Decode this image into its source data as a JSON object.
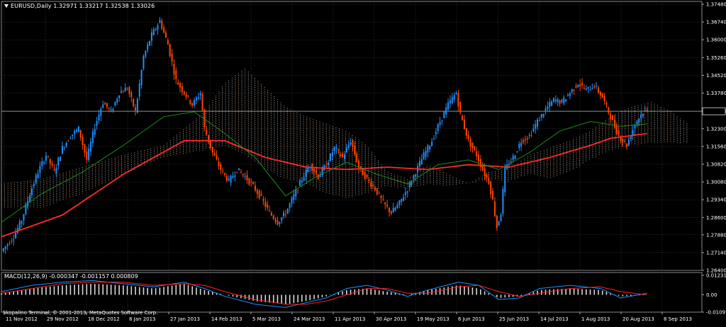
{
  "header": {
    "symbol_label": "EURUSD,Daily",
    "ohlc": "1.32971 1.33217 1.32538 1.33026"
  },
  "macd_header": {
    "label": "MACD(12,26,9) -0.000347 -0.001157 0.000809"
  },
  "footer": {
    "copyright": "Skopalino Terminal, © 2001-2013, MetaQuotes Software Corp."
  },
  "colors": {
    "background": "#000000",
    "bull_candle": "#1e90ff",
    "bear_candle": "#ff4500",
    "ma_slow": "#ff2a2a",
    "ma_fast": "#1d8c1d",
    "cloud_dots": "#e6b08a",
    "cloud_dots_alt": "#d9d9d9",
    "macd_hist": "#d9d9d9",
    "macd_main": "#1e90ff",
    "macd_signal": "#ff2020",
    "grid": "#5a5a5a",
    "current_price_line": "#c0c0c0"
  },
  "chart_data": [
    {
      "type": "candlestick",
      "title": "EURUSD,Daily",
      "ylim": [
        1.264,
        1.3748
      ],
      "y_ticks": [
        "1.37480",
        "1.36740",
        "1.36000",
        "1.35260",
        "1.34520",
        "1.33780",
        "1.33026",
        "1.32300",
        "1.31560",
        "1.30820",
        "1.30080",
        "1.29340",
        "1.28600",
        "1.27880",
        "1.27140",
        "1.26400"
      ],
      "current_price": "1.33026",
      "current_price_value": 1.33026,
      "x_labels": [
        "11 Nov 2012",
        "29 Nov 2012",
        "18 Dec 2012",
        "8 Jan 2013",
        "27 Jan 2013",
        "14 Feb 2013",
        "5 Mar 2013",
        "24 Mar 2013",
        "11 Apr 2013",
        "30 Apr 2013",
        "19 May 2013",
        "6 Jun 2013",
        "25 Jun 2013",
        "14 Jul 2013",
        "1 Aug 2013",
        "20 Aug 2013",
        "8 Sep 2013"
      ],
      "close_path": [
        [
          0,
          1.272
        ],
        [
          6,
          1.278
        ],
        [
          10,
          1.285
        ],
        [
          14,
          1.296
        ],
        [
          18,
          1.305
        ],
        [
          22,
          1.312
        ],
        [
          26,
          1.305
        ],
        [
          30,
          1.315
        ],
        [
          34,
          1.32
        ],
        [
          38,
          1.323
        ],
        [
          42,
          1.31
        ],
        [
          46,
          1.324
        ],
        [
          50,
          1.334
        ],
        [
          54,
          1.33
        ],
        [
          58,
          1.338
        ],
        [
          62,
          1.34
        ],
        [
          66,
          1.33
        ],
        [
          70,
          1.353
        ],
        [
          74,
          1.362
        ],
        [
          78,
          1.368
        ],
        [
          82,
          1.358
        ],
        [
          86,
          1.343
        ],
        [
          90,
          1.338
        ],
        [
          94,
          1.333
        ],
        [
          98,
          1.338
        ],
        [
          100,
          1.323
        ],
        [
          104,
          1.313
        ],
        [
          108,
          1.306
        ],
        [
          112,
          1.301
        ],
        [
          116,
          1.306
        ],
        [
          120,
          1.303
        ],
        [
          124,
          1.299
        ],
        [
          128,
          1.294
        ],
        [
          132,
          1.288
        ],
        [
          136,
          1.284
        ],
        [
          140,
          1.288
        ],
        [
          144,
          1.295
        ],
        [
          148,
          1.302
        ],
        [
          152,
          1.308
        ],
        [
          156,
          1.303
        ],
        [
          160,
          1.308
        ],
        [
          164,
          1.315
        ],
        [
          168,
          1.311
        ],
        [
          172,
          1.318
        ],
        [
          176,
          1.307
        ],
        [
          180,
          1.302
        ],
        [
          184,
          1.298
        ],
        [
          188,
          1.292
        ],
        [
          192,
          1.288
        ],
        [
          196,
          1.292
        ],
        [
          200,
          1.298
        ],
        [
          204,
          1.305
        ],
        [
          208,
          1.312
        ],
        [
          212,
          1.318
        ],
        [
          216,
          1.326
        ],
        [
          220,
          1.333
        ],
        [
          224,
          1.338
        ],
        [
          226,
          1.329
        ],
        [
          230,
          1.318
        ],
        [
          234,
          1.312
        ],
        [
          238,
          1.304
        ],
        [
          240,
          1.301
        ],
        [
          242,
          1.293
        ],
        [
          244,
          1.282
        ],
        [
          246,
          1.288
        ],
        [
          248,
          1.306
        ],
        [
          252,
          1.311
        ],
        [
          256,
          1.318
        ],
        [
          260,
          1.32
        ],
        [
          264,
          1.326
        ],
        [
          268,
          1.331
        ],
        [
          272,
          1.335
        ],
        [
          276,
          1.334
        ],
        [
          280,
          1.338
        ],
        [
          284,
          1.342
        ],
        [
          288,
          1.339
        ],
        [
          292,
          1.341
        ],
        [
          296,
          1.336
        ],
        [
          300,
          1.328
        ],
        [
          304,
          1.32
        ],
        [
          308,
          1.316
        ],
        [
          312,
          1.325
        ],
        [
          316,
          1.33
        ],
        [
          318,
          1.33026
        ]
      ],
      "series": [
        {
          "name": "",
          "kind": "ma_slow",
          "points": [
            [
              0,
              1.278
            ],
            [
              30,
              1.287
            ],
            [
              60,
              1.304
            ],
            [
              90,
              1.318
            ],
            [
              110,
              1.318
            ],
            [
              130,
              1.311
            ],
            [
              150,
              1.307
            ],
            [
              170,
              1.306
            ],
            [
              190,
              1.307
            ],
            [
              210,
              1.306
            ],
            [
              230,
              1.308
            ],
            [
              250,
              1.307
            ],
            [
              270,
              1.311
            ],
            [
              290,
              1.316
            ],
            [
              300,
              1.319
            ],
            [
              318,
              1.321
            ]
          ]
        },
        {
          "name": "",
          "kind": "ma_fast",
          "points": [
            [
              0,
              1.284
            ],
            [
              20,
              1.296
            ],
            [
              40,
              1.305
            ],
            [
              60,
              1.316
            ],
            [
              80,
              1.328
            ],
            [
              95,
              1.33
            ],
            [
              110,
              1.321
            ],
            [
              125,
              1.311
            ],
            [
              140,
              1.295
            ],
            [
              155,
              1.303
            ],
            [
              170,
              1.309
            ],
            [
              185,
              1.304
            ],
            [
              200,
              1.3
            ],
            [
              215,
              1.308
            ],
            [
              230,
              1.31
            ],
            [
              245,
              1.306
            ],
            [
              260,
              1.313
            ],
            [
              275,
              1.322
            ],
            [
              290,
              1.326
            ],
            [
              305,
              1.324
            ],
            [
              318,
              1.325
            ]
          ]
        }
      ],
      "cloud": {
        "upper": [
          [
            0,
            1.3
          ],
          [
            20,
            1.302
          ],
          [
            40,
            1.307
          ],
          [
            60,
            1.312
          ],
          [
            80,
            1.316
          ],
          [
            100,
            1.33
          ],
          [
            110,
            1.342
          ],
          [
            120,
            1.348
          ],
          [
            130,
            1.34
          ],
          [
            140,
            1.332
          ],
          [
            150,
            1.328
          ],
          [
            160,
            1.325
          ],
          [
            170,
            1.322
          ],
          [
            180,
            1.316
          ],
          [
            190,
            1.305
          ],
          [
            200,
            1.302
          ],
          [
            210,
            1.308
          ],
          [
            220,
            1.304
          ],
          [
            230,
            1.3
          ],
          [
            240,
            1.305
          ],
          [
            250,
            1.306
          ],
          [
            260,
            1.312
          ],
          [
            270,
            1.315
          ],
          [
            280,
            1.318
          ],
          [
            290,
            1.322
          ],
          [
            300,
            1.328
          ],
          [
            310,
            1.332
          ],
          [
            320,
            1.334
          ],
          [
            330,
            1.33
          ],
          [
            338,
            1.325
          ]
        ],
        "lower": [
          [
            0,
            1.29
          ],
          [
            20,
            1.29
          ],
          [
            40,
            1.296
          ],
          [
            60,
            1.304
          ],
          [
            80,
            1.311
          ],
          [
            100,
            1.314
          ],
          [
            110,
            1.316
          ],
          [
            120,
            1.312
          ],
          [
            130,
            1.306
          ],
          [
            140,
            1.302
          ],
          [
            150,
            1.3
          ],
          [
            160,
            1.296
          ],
          [
            170,
            1.294
          ],
          [
            180,
            1.296
          ],
          [
            190,
            1.299
          ],
          [
            200,
            1.298
          ],
          [
            210,
            1.3
          ],
          [
            220,
            1.299
          ],
          [
            230,
            1.3
          ],
          [
            240,
            1.302
          ],
          [
            250,
            1.301
          ],
          [
            260,
            1.304
          ],
          [
            270,
            1.302
          ],
          [
            280,
            1.305
          ],
          [
            290,
            1.31
          ],
          [
            300,
            1.314
          ],
          [
            310,
            1.316
          ],
          [
            320,
            1.317
          ],
          [
            330,
            1.317
          ],
          [
            338,
            1.317
          ]
        ]
      }
    },
    {
      "type": "bar",
      "title": "MACD(12,26,9)",
      "ylim": [
        -0.010975,
        0.012318
      ],
      "y_ticks": [
        "0.012318",
        "0.00",
        "-0.010975"
      ],
      "histogram": [
        [
          0,
          0.001
        ],
        [
          15,
          0.004
        ],
        [
          30,
          0.006
        ],
        [
          45,
          0.007
        ],
        [
          60,
          0.006
        ],
        [
          75,
          0.004
        ],
        [
          90,
          0.007
        ],
        [
          100,
          0.003
        ],
        [
          110,
          0.0
        ],
        [
          125,
          -0.004
        ],
        [
          140,
          -0.006
        ],
        [
          150,
          -0.004
        ],
        [
          160,
          -0.001
        ],
        [
          170,
          0.003
        ],
        [
          180,
          0.004
        ],
        [
          190,
          0.002
        ],
        [
          200,
          0.0
        ],
        [
          210,
          0.003
        ],
        [
          225,
          0.006
        ],
        [
          235,
          0.004
        ],
        [
          245,
          -0.002
        ],
        [
          255,
          -0.001
        ],
        [
          265,
          0.003
        ],
        [
          280,
          0.004
        ],
        [
          295,
          0.003
        ],
        [
          305,
          -0.001
        ],
        [
          318,
          0.0
        ]
      ],
      "main": [
        [
          0,
          0.002
        ],
        [
          15,
          0.006
        ],
        [
          30,
          0.008
        ],
        [
          45,
          0.009
        ],
        [
          60,
          0.007
        ],
        [
          75,
          0.005
        ],
        [
          90,
          0.008
        ],
        [
          100,
          0.004
        ],
        [
          110,
          -0.001
        ],
        [
          125,
          -0.006
        ],
        [
          140,
          -0.008
        ],
        [
          150,
          -0.005
        ],
        [
          160,
          -0.002
        ],
        [
          170,
          0.004
        ],
        [
          180,
          0.006
        ],
        [
          190,
          0.003
        ],
        [
          200,
          -0.001
        ],
        [
          210,
          0.003
        ],
        [
          225,
          0.008
        ],
        [
          235,
          0.006
        ],
        [
          245,
          -0.003
        ],
        [
          255,
          -0.002
        ],
        [
          265,
          0.004
        ],
        [
          280,
          0.006
        ],
        [
          295,
          0.004
        ],
        [
          305,
          -0.002
        ],
        [
          318,
          0.001
        ]
      ],
      "signal": [
        [
          0,
          0.001
        ],
        [
          15,
          0.004
        ],
        [
          30,
          0.007
        ],
        [
          45,
          0.008
        ],
        [
          60,
          0.008
        ],
        [
          75,
          0.006
        ],
        [
          90,
          0.007
        ],
        [
          100,
          0.006
        ],
        [
          110,
          0.002
        ],
        [
          125,
          -0.003
        ],
        [
          140,
          -0.006
        ],
        [
          150,
          -0.006
        ],
        [
          160,
          -0.004
        ],
        [
          170,
          0.0
        ],
        [
          180,
          0.004
        ],
        [
          190,
          0.004
        ],
        [
          200,
          0.001
        ],
        [
          210,
          0.001
        ],
        [
          225,
          0.005
        ],
        [
          235,
          0.006
        ],
        [
          245,
          0.002
        ],
        [
          255,
          -0.001
        ],
        [
          265,
          0.001
        ],
        [
          280,
          0.004
        ],
        [
          295,
          0.005
        ],
        [
          305,
          0.002
        ],
        [
          318,
          0.0
        ]
      ]
    }
  ]
}
